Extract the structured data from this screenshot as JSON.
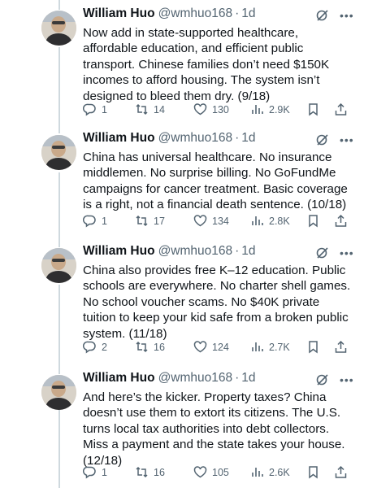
{
  "author": {
    "name": "William Huo",
    "handle": "@wmhuo168",
    "separator": "·",
    "time": "1d"
  },
  "icons": {
    "grok": "grok-icon",
    "more": "more-icon",
    "reply": "reply-icon",
    "retweet": "retweet-icon",
    "like": "heart-icon",
    "views": "views-icon",
    "bookmark": "bookmark-icon",
    "share": "share-icon"
  },
  "colors": {
    "text": "#0f1419",
    "secondary": "#536471",
    "thread_line": "#cfd9de"
  },
  "tweets": [
    {
      "text": "Now add in state-supported healthcare,\naffordable education, and efficient public\ntransport. Chinese families don’t need $150K\nincomes to afford housing. The system isn’t\ndesigned to bleed them dry. (9/18)",
      "replies": "1",
      "retweets": "14",
      "likes": "130",
      "views": "2.9K"
    },
    {
      "text": "China has universal healthcare. No insurance\nmiddlemen. No surprise billing. No GoFundMe\ncampaigns for cancer treatment. Basic coverage\nis a right, not a financial death sentence. (10/18)",
      "replies": "1",
      "retweets": "17",
      "likes": "134",
      "views": "2.8K"
    },
    {
      "text": "China also provides free K–12 education. Public\nschools are everywhere. No charter shell games.\nNo school voucher scams. No $40K private\ntuition to keep your kid safe from a broken public\nsystem. (11/18)",
      "replies": "2",
      "retweets": "16",
      "likes": "124",
      "views": "2.7K"
    },
    {
      "text": "And here’s the kicker. Property taxes? China\ndoesn’t use them to extort its citizens. The U.S.\nturns local tax authorities into debt collectors.\nMiss a payment and the state takes your house.\n(12/18)",
      "replies": "1",
      "retweets": "16",
      "likes": "105",
      "views": "2.6K"
    }
  ]
}
